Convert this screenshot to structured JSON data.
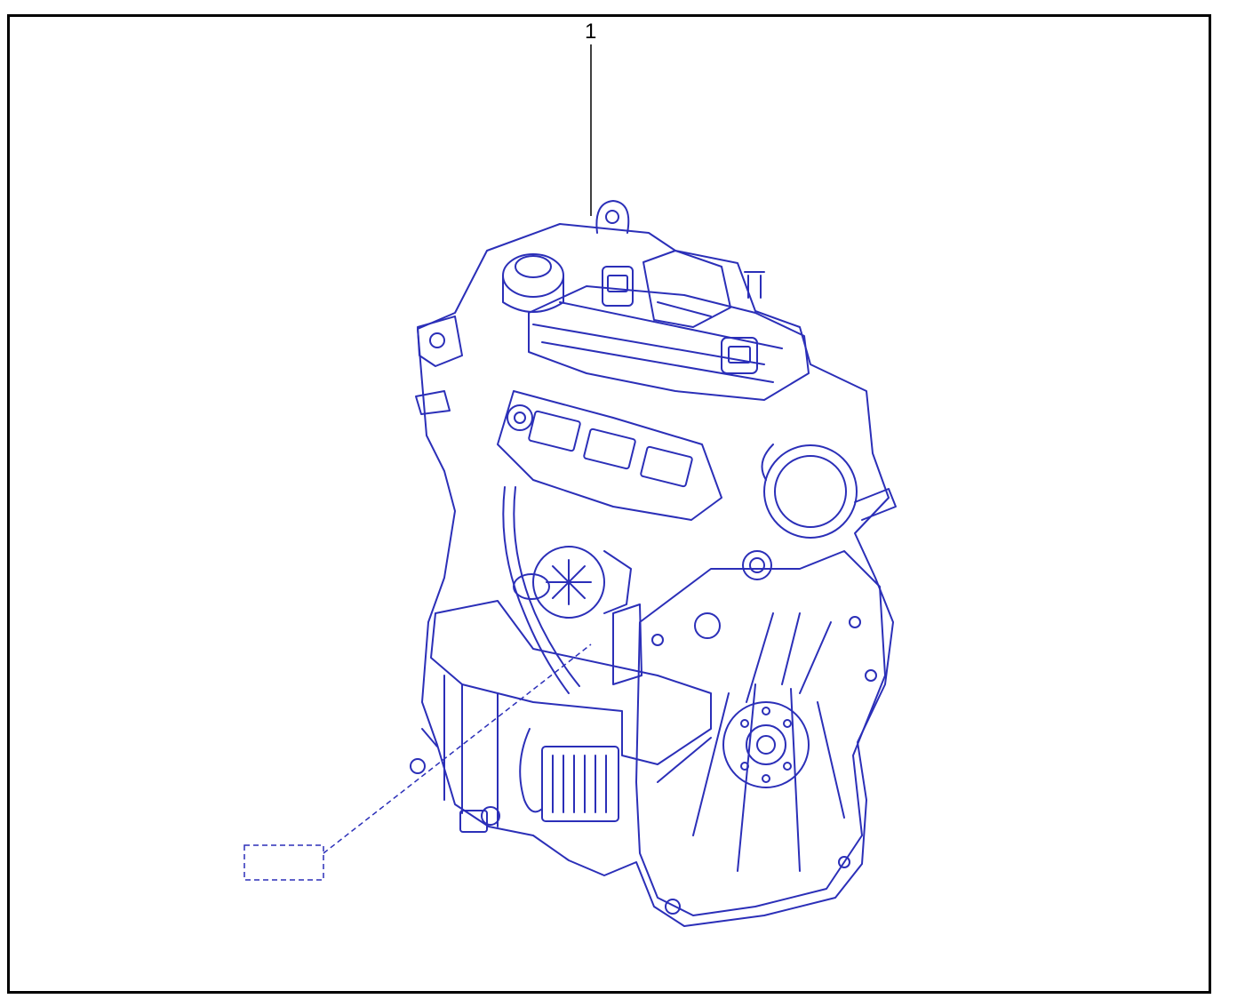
{
  "diagram": {
    "callouts": [
      {
        "number": "1"
      }
    ],
    "colors": {
      "line": "#2b2fb8",
      "callout": "#000000",
      "frame": "#000000",
      "background": "#ffffff"
    }
  }
}
